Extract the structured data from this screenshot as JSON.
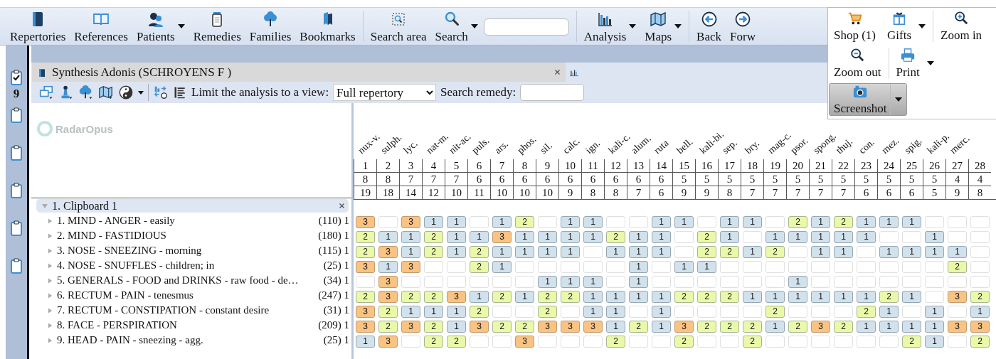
{
  "toolbar": {
    "groups": [
      {
        "items": [
          {
            "kind": "button",
            "label": "Repertories",
            "dropdown": false
          },
          {
            "kind": "button",
            "label": "References",
            "dropdown": false
          },
          {
            "kind": "button",
            "label": "Patients",
            "dropdown": true
          },
          {
            "kind": "button",
            "label": "Remedies",
            "dropdown": false
          },
          {
            "kind": "button",
            "label": "Families",
            "dropdown": false
          },
          {
            "kind": "button",
            "label": "Bookmarks",
            "dropdown": false
          }
        ]
      },
      {
        "items": [
          {
            "kind": "button",
            "label": "Search area",
            "dropdown": false
          },
          {
            "kind": "button",
            "label": "Search",
            "dropdown": true
          },
          {
            "kind": "field"
          }
        ]
      },
      {
        "items": [
          {
            "kind": "button",
            "label": "Analysis",
            "dropdown": true
          },
          {
            "kind": "button",
            "label": "Maps",
            "dropdown": true
          }
        ]
      },
      {
        "items": [
          {
            "kind": "button",
            "label": "Back",
            "dropdown": false
          },
          {
            "kind": "button",
            "label": "Forw",
            "dropdown": false
          }
        ]
      }
    ]
  },
  "overflow_menu": {
    "rows": [
      {
        "groups": [
          {
            "buttons": [
              {
                "label": "Shop (1)",
                "dropdown": false,
                "highlighted": false
              },
              {
                "label": "Gifts",
                "dropdown": true,
                "highlighted": false
              }
            ]
          },
          {
            "buttons": [
              {
                "label": "Zoom in",
                "dropdown": false,
                "highlighted": false
              }
            ]
          }
        ]
      },
      {
        "groups": [
          {
            "buttons": [
              {
                "label": "Zoom out",
                "dropdown": false,
                "highlighted": false
              }
            ]
          },
          {
            "buttons": [
              {
                "label": "Print",
                "dropdown": true,
                "highlighted": false
              }
            ]
          }
        ]
      },
      {
        "groups": [
          {
            "buttons": [
              {
                "label": "Screenshot",
                "dropdown": true,
                "highlighted": true
              }
            ]
          }
        ]
      }
    ]
  },
  "sidebar": {
    "clipboards": [
      {
        "checked": true,
        "count": "9"
      },
      {
        "checked": false
      },
      {
        "checked": false
      },
      {
        "checked": false
      },
      {
        "checked": false
      },
      {
        "checked": false
      }
    ]
  },
  "document": {
    "tab": {
      "title": "Synthesis Adonis (SCHROYENS F )"
    },
    "view_filter": {
      "label": "Limit the analysis to a view:",
      "value": "Full repertory"
    },
    "remedy_search": {
      "label": "Search remedy:"
    },
    "logo": "RadarOpus",
    "clipboard": {
      "title": "1. Clipboard 1",
      "expanded": true,
      "rubrics": [
        {
          "label": "1. MIND - ANGER - easily",
          "count": "(110) 1",
          "expanded": false,
          "cells": [
            "3",
            null,
            "3",
            "1",
            "1",
            null,
            "1",
            "2",
            null,
            "1",
            "1",
            null,
            null,
            "1",
            "1",
            null,
            "1",
            "1",
            null,
            "2",
            "1",
            "2",
            "1",
            "1",
            "1",
            null,
            null,
            null
          ]
        },
        {
          "label": "2. MIND - FASTIDIOUS",
          "count": "(180) 1",
          "expanded": false,
          "cells": [
            "2",
            "1",
            "1",
            "2",
            "1",
            "1",
            "3",
            "1",
            "1",
            "1",
            "1",
            "2",
            "1",
            "1",
            null,
            "2",
            "1",
            null,
            "1",
            "1",
            "1",
            "1",
            "1",
            null,
            null,
            "1",
            null,
            null
          ]
        },
        {
          "label": "3. NOSE - SNEEZING - morning",
          "count": "(115) 1",
          "expanded": false,
          "cells": [
            "2",
            "3",
            "1",
            "2",
            "1",
            "2",
            "1",
            "1",
            "1",
            "1",
            null,
            "1",
            "1",
            "1",
            null,
            "2",
            "2",
            "1",
            "2",
            null,
            "1",
            "1",
            null,
            "1",
            "1",
            "1",
            "1",
            null
          ]
        },
        {
          "label": "4. NOSE - SNUFFLES - children; in",
          "count": "(25) 1",
          "expanded": false,
          "cells": [
            "3",
            "1",
            "3",
            null,
            null,
            "2",
            "1",
            null,
            null,
            null,
            null,
            null,
            "1",
            null,
            "1",
            "1",
            null,
            null,
            null,
            null,
            null,
            null,
            null,
            null,
            null,
            null,
            "2",
            null
          ]
        },
        {
          "label": "5. GENERALS - FOOD and DRINKS - raw food - de…",
          "count": "(34) 1",
          "expanded": false,
          "cells": [
            null,
            "3",
            null,
            null,
            null,
            null,
            null,
            null,
            "1",
            "1",
            "1",
            null,
            "1",
            null,
            null,
            null,
            null,
            null,
            null,
            "1",
            null,
            null,
            null,
            null,
            null,
            null,
            null,
            null
          ]
        },
        {
          "label": "6. RECTUM - PAIN - tenesmus",
          "count": "(247) 1",
          "expanded": false,
          "cells": [
            "2",
            "3",
            "2",
            "2",
            "3",
            "1",
            "2",
            "1",
            "2",
            "2",
            "1",
            "1",
            "1",
            "1",
            "2",
            "2",
            "2",
            "1",
            "1",
            "1",
            "1",
            "1",
            "1",
            "2",
            "1",
            null,
            "3",
            "2"
          ]
        },
        {
          "label": "7. RECTUM - CONSTIPATION - constant desire",
          "count": "(31) 1",
          "expanded": false,
          "cells": [
            "3",
            "2",
            "1",
            "1",
            "1",
            "2",
            null,
            null,
            "2",
            null,
            "1",
            "1",
            null,
            "1",
            null,
            null,
            null,
            null,
            "2",
            null,
            null,
            null,
            "2",
            "1",
            null,
            "1",
            null,
            "1"
          ]
        },
        {
          "label": "8. FACE - PERSPIRATION",
          "count": "(209) 1",
          "expanded": false,
          "cells": [
            "3",
            "2",
            "3",
            "2",
            "1",
            "3",
            "2",
            "2",
            "3",
            "3",
            "3",
            "1",
            "2",
            "1",
            "3",
            "2",
            "2",
            "2",
            "1",
            "2",
            "3",
            "2",
            "1",
            "1",
            "1",
            "1",
            "3",
            "3"
          ]
        },
        {
          "label": "9. HEAD - PAIN - sneezing - agg.",
          "count": "(25) 1",
          "expanded": false,
          "cells": [
            "1",
            "3",
            null,
            "2",
            "2",
            null,
            null,
            "3",
            null,
            null,
            null,
            "2",
            null,
            null,
            "2",
            null,
            null,
            "2",
            null,
            null,
            null,
            null,
            null,
            null,
            "2",
            "1",
            null,
            "2"
          ]
        }
      ]
    },
    "remedies": [
      {
        "name": "nux-v.",
        "number": "1",
        "rubrics": "8",
        "score": "19"
      },
      {
        "name": "sulph.",
        "number": "2",
        "rubrics": "8",
        "score": "18"
      },
      {
        "name": "lyc.",
        "number": "3",
        "rubrics": "7",
        "score": "14"
      },
      {
        "name": "nat-m.",
        "number": "4",
        "rubrics": "7",
        "score": "12"
      },
      {
        "name": "nit-ac.",
        "number": "5",
        "rubrics": "7",
        "score": "10"
      },
      {
        "name": "puls.",
        "number": "6",
        "rubrics": "6",
        "score": "11"
      },
      {
        "name": "ars.",
        "number": "7",
        "rubrics": "6",
        "score": "10"
      },
      {
        "name": "phos.",
        "number": "8",
        "rubrics": "6",
        "score": "10"
      },
      {
        "name": "sil.",
        "number": "9",
        "rubrics": "6",
        "score": "10"
      },
      {
        "name": "calc.",
        "number": "10",
        "rubrics": "6",
        "score": "9"
      },
      {
        "name": "ign.",
        "number": "11",
        "rubrics": "6",
        "score": "8"
      },
      {
        "name": "kali-c.",
        "number": "12",
        "rubrics": "6",
        "score": "8"
      },
      {
        "name": "alum.",
        "number": "13",
        "rubrics": "6",
        "score": "7"
      },
      {
        "name": "ruta",
        "number": "14",
        "rubrics": "6",
        "score": "6"
      },
      {
        "name": "bell.",
        "number": "15",
        "rubrics": "5",
        "score": "9"
      },
      {
        "name": "kali-bi.",
        "number": "16",
        "rubrics": "5",
        "score": "9"
      },
      {
        "name": "sep.",
        "number": "17",
        "rubrics": "5",
        "score": "8"
      },
      {
        "name": "bry.",
        "number": "18",
        "rubrics": "5",
        "score": "7"
      },
      {
        "name": "mag-c.",
        "number": "19",
        "rubrics": "5",
        "score": "7"
      },
      {
        "name": "psor.",
        "number": "20",
        "rubrics": "5",
        "score": "7"
      },
      {
        "name": "spong.",
        "number": "21",
        "rubrics": "5",
        "score": "7"
      },
      {
        "name": "thuj.",
        "number": "22",
        "rubrics": "5",
        "score": "7"
      },
      {
        "name": "con.",
        "number": "23",
        "rubrics": "5",
        "score": "6"
      },
      {
        "name": "mez.",
        "number": "24",
        "rubrics": "5",
        "score": "6"
      },
      {
        "name": "spig.",
        "number": "25",
        "rubrics": "5",
        "score": "6"
      },
      {
        "name": "kali-p.",
        "number": "26",
        "rubrics": "5",
        "score": "5"
      },
      {
        "name": "merc.",
        "number": "27",
        "rubrics": "4",
        "score": "9"
      },
      {
        "number": "28",
        "rubrics": "4",
        "score": "8"
      }
    ]
  }
}
